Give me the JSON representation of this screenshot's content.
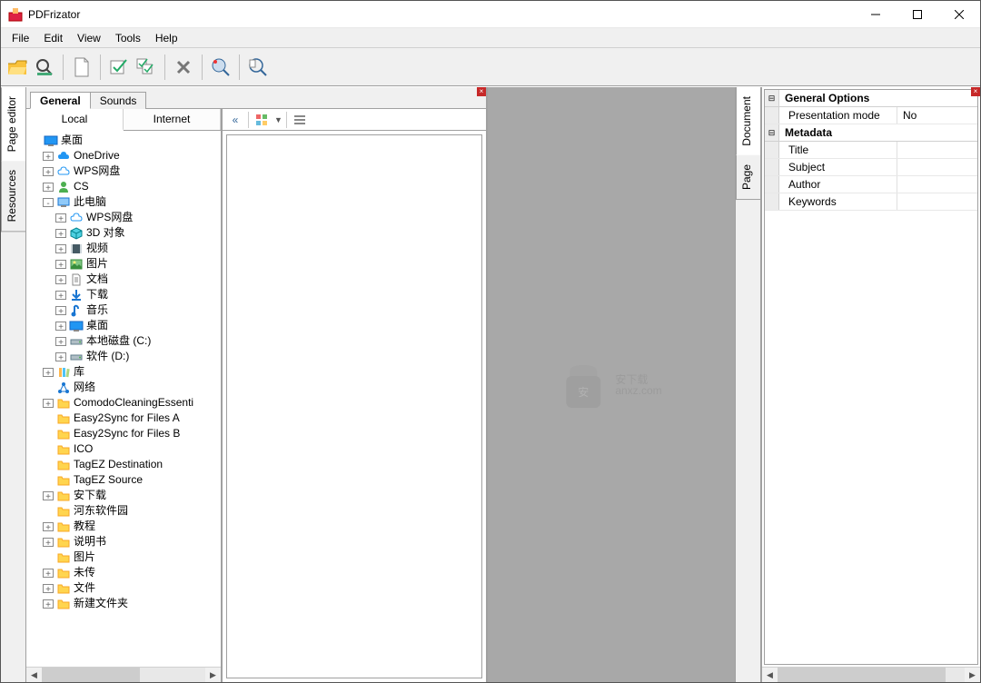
{
  "title": "PDFrizator",
  "menu": [
    "File",
    "Edit",
    "View",
    "Tools",
    "Help"
  ],
  "left_vertical_tabs": [
    "Page editor",
    "Resources"
  ],
  "leftpane_tabs": [
    "General",
    "Sounds"
  ],
  "leftpane_subtabs": [
    "Local",
    "Internet"
  ],
  "right_vertical_tabs": [
    "Document",
    "Page"
  ],
  "tree": [
    {
      "level": 1,
      "twisty": "",
      "icon": "desktop",
      "label": "桌面"
    },
    {
      "level": 2,
      "twisty": "+",
      "icon": "cloud-blue",
      "label": "OneDrive"
    },
    {
      "level": 2,
      "twisty": "+",
      "icon": "cloud-outline",
      "label": "WPS网盘"
    },
    {
      "level": 2,
      "twisty": "+",
      "icon": "user",
      "label": "CS"
    },
    {
      "level": 2,
      "twisty": "-",
      "icon": "computer",
      "label": "此电脑"
    },
    {
      "level": 3,
      "twisty": "+",
      "icon": "cloud-outline",
      "label": "WPS网盘"
    },
    {
      "level": 3,
      "twisty": "+",
      "icon": "cube",
      "label": "3D 对象"
    },
    {
      "level": 3,
      "twisty": "+",
      "icon": "video",
      "label": "视频"
    },
    {
      "level": 3,
      "twisty": "+",
      "icon": "picture",
      "label": "图片"
    },
    {
      "level": 3,
      "twisty": "+",
      "icon": "document",
      "label": "文档"
    },
    {
      "level": 3,
      "twisty": "+",
      "icon": "download",
      "label": "下载"
    },
    {
      "level": 3,
      "twisty": "+",
      "icon": "music",
      "label": "音乐"
    },
    {
      "level": 3,
      "twisty": "+",
      "icon": "desktop",
      "label": "桌面"
    },
    {
      "level": 3,
      "twisty": "+",
      "icon": "drive",
      "label": "本地磁盘 (C:)"
    },
    {
      "level": 3,
      "twisty": "+",
      "icon": "drive",
      "label": "软件 (D:)"
    },
    {
      "level": 2,
      "twisty": "+",
      "icon": "library",
      "label": "库"
    },
    {
      "level": 2,
      "twisty": "",
      "icon": "network",
      "label": "网络"
    },
    {
      "level": 2,
      "twisty": "+",
      "icon": "folder",
      "label": "ComodoCleaningEssenti"
    },
    {
      "level": 2,
      "twisty": "",
      "icon": "folder",
      "label": "Easy2Sync for Files A"
    },
    {
      "level": 2,
      "twisty": "",
      "icon": "folder",
      "label": "Easy2Sync for Files B"
    },
    {
      "level": 2,
      "twisty": "",
      "icon": "folder",
      "label": "ICO"
    },
    {
      "level": 2,
      "twisty": "",
      "icon": "folder",
      "label": "TagEZ Destination"
    },
    {
      "level": 2,
      "twisty": "",
      "icon": "folder",
      "label": "TagEZ Source"
    },
    {
      "level": 2,
      "twisty": "+",
      "icon": "folder",
      "label": "安下载"
    },
    {
      "level": 2,
      "twisty": "",
      "icon": "folder",
      "label": "河东软件园"
    },
    {
      "level": 2,
      "twisty": "+",
      "icon": "folder",
      "label": "教程"
    },
    {
      "level": 2,
      "twisty": "+",
      "icon": "folder",
      "label": "说明书"
    },
    {
      "level": 2,
      "twisty": "",
      "icon": "folder",
      "label": "图片"
    },
    {
      "level": 2,
      "twisty": "+",
      "icon": "folder",
      "label": "未传"
    },
    {
      "level": 2,
      "twisty": "+",
      "icon": "folder",
      "label": "文件"
    },
    {
      "level": 2,
      "twisty": "+",
      "icon": "folder",
      "label": "新建文件夹"
    }
  ],
  "properties": {
    "cat1": "General Options",
    "presentation_mode_label": "Presentation mode",
    "presentation_mode_value": "No",
    "cat2": "Metadata",
    "title_label": "Title",
    "title_value": "",
    "subject_label": "Subject",
    "subject_value": "",
    "author_label": "Author",
    "author_value": "",
    "keywords_label": "Keywords",
    "keywords_value": ""
  },
  "thumb_toolbar_collapse": "«",
  "watermark": "安下载\nanxz.com"
}
